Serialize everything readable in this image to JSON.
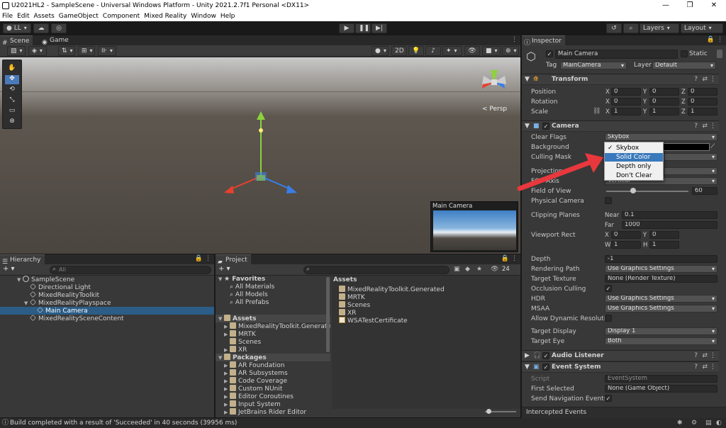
{
  "window": {
    "title": "U2021HL2 - SampleScene - Universal Windows Platform - Unity 2021.2.7f1 Personal <DX11>"
  },
  "menu": [
    "File",
    "Edit",
    "Assets",
    "GameObject",
    "Component",
    "Mixed Reality",
    "Window",
    "Help"
  ],
  "toolbar": {
    "account": "LL",
    "layers": "Layers",
    "layout": "Layout"
  },
  "scene": {
    "tabs": [
      "Scene",
      "Game"
    ],
    "mode_2d": "2D",
    "persp": "< Persp",
    "preview_title": "Main Camera"
  },
  "hierarchy": {
    "tab": "Hierarchy",
    "search_placeholder": "All",
    "items": [
      {
        "label": "SampleScene",
        "depth": 0,
        "kind": "scene"
      },
      {
        "label": "Directional Light",
        "depth": 1,
        "kind": "go"
      },
      {
        "label": "MixedRealityToolkit",
        "depth": 1,
        "kind": "go"
      },
      {
        "label": "MixedRealityPlayspace",
        "depth": 1,
        "kind": "go"
      },
      {
        "label": "Main Camera",
        "depth": 2,
        "kind": "go",
        "selected": true
      },
      {
        "label": "MixedRealitySceneContent",
        "depth": 1,
        "kind": "go"
      }
    ]
  },
  "project": {
    "tab": "Project",
    "count": "24",
    "tree": [
      {
        "label": "Favorites",
        "depth": 0,
        "kind": "star",
        "bold": true
      },
      {
        "label": "All Materials",
        "depth": 1,
        "kind": "search"
      },
      {
        "label": "All Models",
        "depth": 1,
        "kind": "search"
      },
      {
        "label": "All Prefabs",
        "depth": 1,
        "kind": "search"
      },
      {
        "label": "",
        "depth": 0,
        "kind": "spacer"
      },
      {
        "label": "Assets",
        "depth": 0,
        "kind": "folder",
        "bold": true,
        "header": true
      },
      {
        "label": "MixedRealityToolkit.Generate",
        "depth": 1,
        "kind": "folder"
      },
      {
        "label": "MRTK",
        "depth": 1,
        "kind": "folder"
      },
      {
        "label": "Scenes",
        "depth": 1,
        "kind": "folder"
      },
      {
        "label": "XR",
        "depth": 1,
        "kind": "folder"
      },
      {
        "label": "Packages",
        "depth": 0,
        "kind": "folder",
        "bold": true,
        "header": true
      },
      {
        "label": "AR Foundation",
        "depth": 1,
        "kind": "folder"
      },
      {
        "label": "AR Subsystems",
        "depth": 1,
        "kind": "folder"
      },
      {
        "label": "Code Coverage",
        "depth": 1,
        "kind": "folder"
      },
      {
        "label": "Custom NUnit",
        "depth": 1,
        "kind": "folder"
      },
      {
        "label": "Editor Coroutines",
        "depth": 1,
        "kind": "folder"
      },
      {
        "label": "Input System",
        "depth": 1,
        "kind": "folder"
      },
      {
        "label": "JetBrains Rider Editor",
        "depth": 1,
        "kind": "folder"
      }
    ],
    "assets_title": "Assets",
    "assets": [
      {
        "label": "MixedRealityToolkit.Generated",
        "kind": "folder"
      },
      {
        "label": "MRTK",
        "kind": "folder"
      },
      {
        "label": "Scenes",
        "kind": "folder"
      },
      {
        "label": "XR",
        "kind": "folder"
      },
      {
        "label": "WSATestCertificate",
        "kind": "cert"
      }
    ]
  },
  "inspector": {
    "tab": "Inspector",
    "object_name": "Main Camera",
    "static_label": "Static",
    "tag_label": "Tag",
    "tag": "MainCamera",
    "layer_label": "Layer",
    "layer": "Default",
    "transform": {
      "title": "Transform",
      "rows": [
        {
          "label": "Position",
          "x": "0",
          "y": "0",
          "z": "0"
        },
        {
          "label": "Rotation",
          "x": "0",
          "y": "0",
          "z": "0"
        },
        {
          "label": "Scale",
          "x": "1",
          "y": "1",
          "z": "1"
        }
      ]
    },
    "camera": {
      "title": "Camera",
      "clear_flags_label": "Clear Flags",
      "clear_flags": "Skybox",
      "background_label": "Background",
      "culling_label": "Culling Mask",
      "projection_label": "Projection",
      "fov_axis_label": "FOV Axis",
      "fov_axis": "Vertical",
      "fov_label": "Field of View",
      "fov": "60",
      "fov_fraction": 0.33,
      "physical_label": "Physical Camera",
      "clipping_label": "Clipping Planes",
      "near_label": "Near",
      "near": "0.1",
      "far_label": "Far",
      "far": "1000",
      "viewport_label": "Viewport Rect",
      "vx": "0",
      "vy": "0",
      "vw": "1",
      "vh": "1",
      "depth_label": "Depth",
      "depth": "-1",
      "rendering_label": "Rendering Path",
      "rendering": "Use Graphics Settings",
      "target_tex_label": "Target Texture",
      "target_tex": "None (Render Texture)",
      "occlusion_label": "Occlusion Culling",
      "hdr_label": "HDR",
      "hdr": "Use Graphics Settings",
      "msaa_label": "MSAA",
      "msaa": "Use Graphics Settings",
      "dyn_label": "Allow Dynamic Resolutio",
      "target_display_label": "Target Display",
      "target_display": "Display 1",
      "target_eye_label": "Target Eye",
      "target_eye": "Both"
    },
    "dropdown": {
      "options": [
        "Skybox",
        "Solid Color",
        "Depth only",
        "Don't Clear"
      ],
      "checked": 0,
      "hovered": 1
    },
    "audio_listener": "Audio Listener",
    "event_system": {
      "title": "Event System",
      "script_label": "Script",
      "script": "EventSystem",
      "first_label": "First Selected",
      "first": "None (Game Object)",
      "nav_label": "Send Navigation Events"
    },
    "intercepted": "Intercepted Events"
  },
  "status": {
    "message": "Build completed with a result of 'Succeeded' in 40 seconds (39956 ms)"
  },
  "colors": {
    "accent_selection": "#2c5d87",
    "arrow": "#e8383d",
    "dropdown_hover": "#3a79bb"
  }
}
